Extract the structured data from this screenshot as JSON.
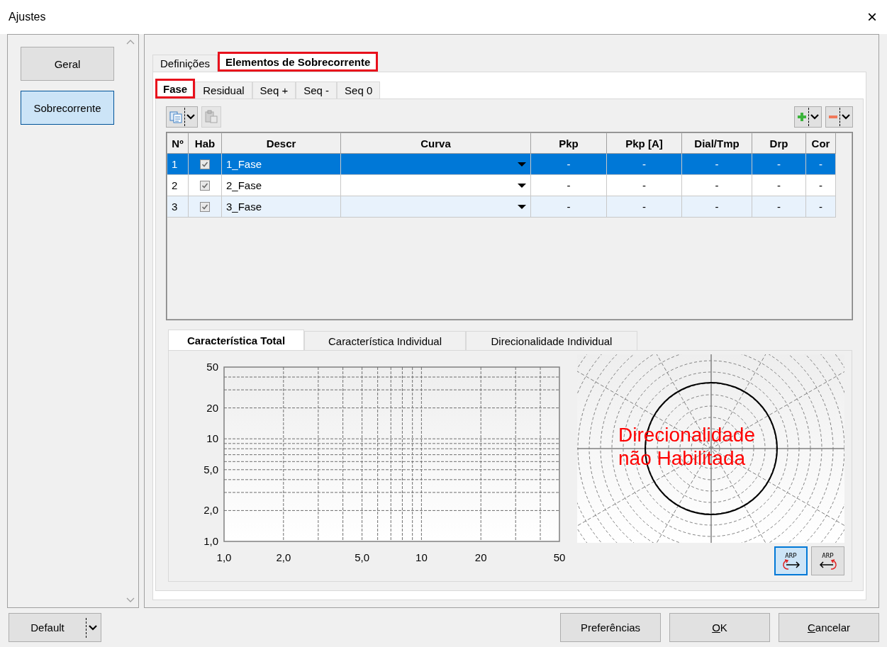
{
  "window": {
    "title": "Ajustes",
    "close": "×"
  },
  "sidebar": {
    "items": [
      {
        "label": "Geral",
        "selected": false
      },
      {
        "label": "Sobrecorrente",
        "selected": true
      }
    ]
  },
  "tabs": [
    {
      "label": "Definições",
      "selected": false,
      "highlighted": false
    },
    {
      "label": "Elementos de Sobrecorrente",
      "selected": true,
      "highlighted": true
    }
  ],
  "subtabs": [
    {
      "label": "Fase",
      "selected": true,
      "highlighted": true
    },
    {
      "label": "Residual",
      "selected": false,
      "highlighted": false
    },
    {
      "label": "Seq +",
      "selected": false,
      "highlighted": false
    },
    {
      "label": "Seq -",
      "selected": false,
      "highlighted": false
    },
    {
      "label": "Seq 0",
      "selected": false,
      "highlighted": false
    }
  ],
  "toolbar": [
    {
      "kind": "copy",
      "disabled": false
    },
    {
      "kind": "paste",
      "disabled": true
    },
    {
      "kind": "add",
      "disabled": false
    },
    {
      "kind": "remove",
      "disabled": false
    }
  ],
  "table": {
    "columns": [
      "Nº",
      "Hab",
      "Descr",
      "Curva",
      "Pkp",
      "Pkp [A]",
      "Dial/Tmp",
      "Drp",
      "Cor"
    ],
    "rows": [
      {
        "selected": true,
        "enabled": true,
        "no": "1",
        "descr": "1_Fase",
        "pkp": "-",
        "pkp_a": "-",
        "dial_tmp": "-",
        "drp": "-",
        "cor": "-"
      },
      {
        "selected": false,
        "enabled": true,
        "no": "2",
        "descr": "2_Fase",
        "pkp": "-",
        "pkp_a": "-",
        "dial_tmp": "-",
        "drp": "-",
        "cor": "-"
      },
      {
        "selected": false,
        "enabled": true,
        "no": "3",
        "descr": "3_Fase",
        "pkp": "-",
        "pkp_a": "-",
        "dial_tmp": "-",
        "drp": "-",
        "cor": "-"
      }
    ]
  },
  "bottom_tabs": [
    {
      "label": "Característica Total",
      "selected": true
    },
    {
      "label": "Característica Individual",
      "selected": false
    },
    {
      "label": "Direcionalidade Individual",
      "selected": false
    }
  ],
  "plot": {
    "x_tick_labels": [
      "1,0",
      "2,0",
      "5,0",
      "10",
      "20",
      "50"
    ],
    "y_tick_labels": [
      "50",
      "20",
      "10",
      "5,0",
      "2,0",
      "1,0"
    ]
  },
  "polar": {
    "message": "Direcionalidade não Habilitada"
  },
  "arp_buttons": [
    {
      "label": "ARP",
      "kind": "forward",
      "selected": true
    },
    {
      "label": "ARP",
      "kind": "reverse",
      "selected": false
    }
  ],
  "footer": {
    "profile": "Default",
    "buttons": [
      {
        "label": "Preferências",
        "underline_first": false
      },
      {
        "label": "OK",
        "underline_first": true
      },
      {
        "label": "Cancelar",
        "underline_first": true
      }
    ]
  }
}
